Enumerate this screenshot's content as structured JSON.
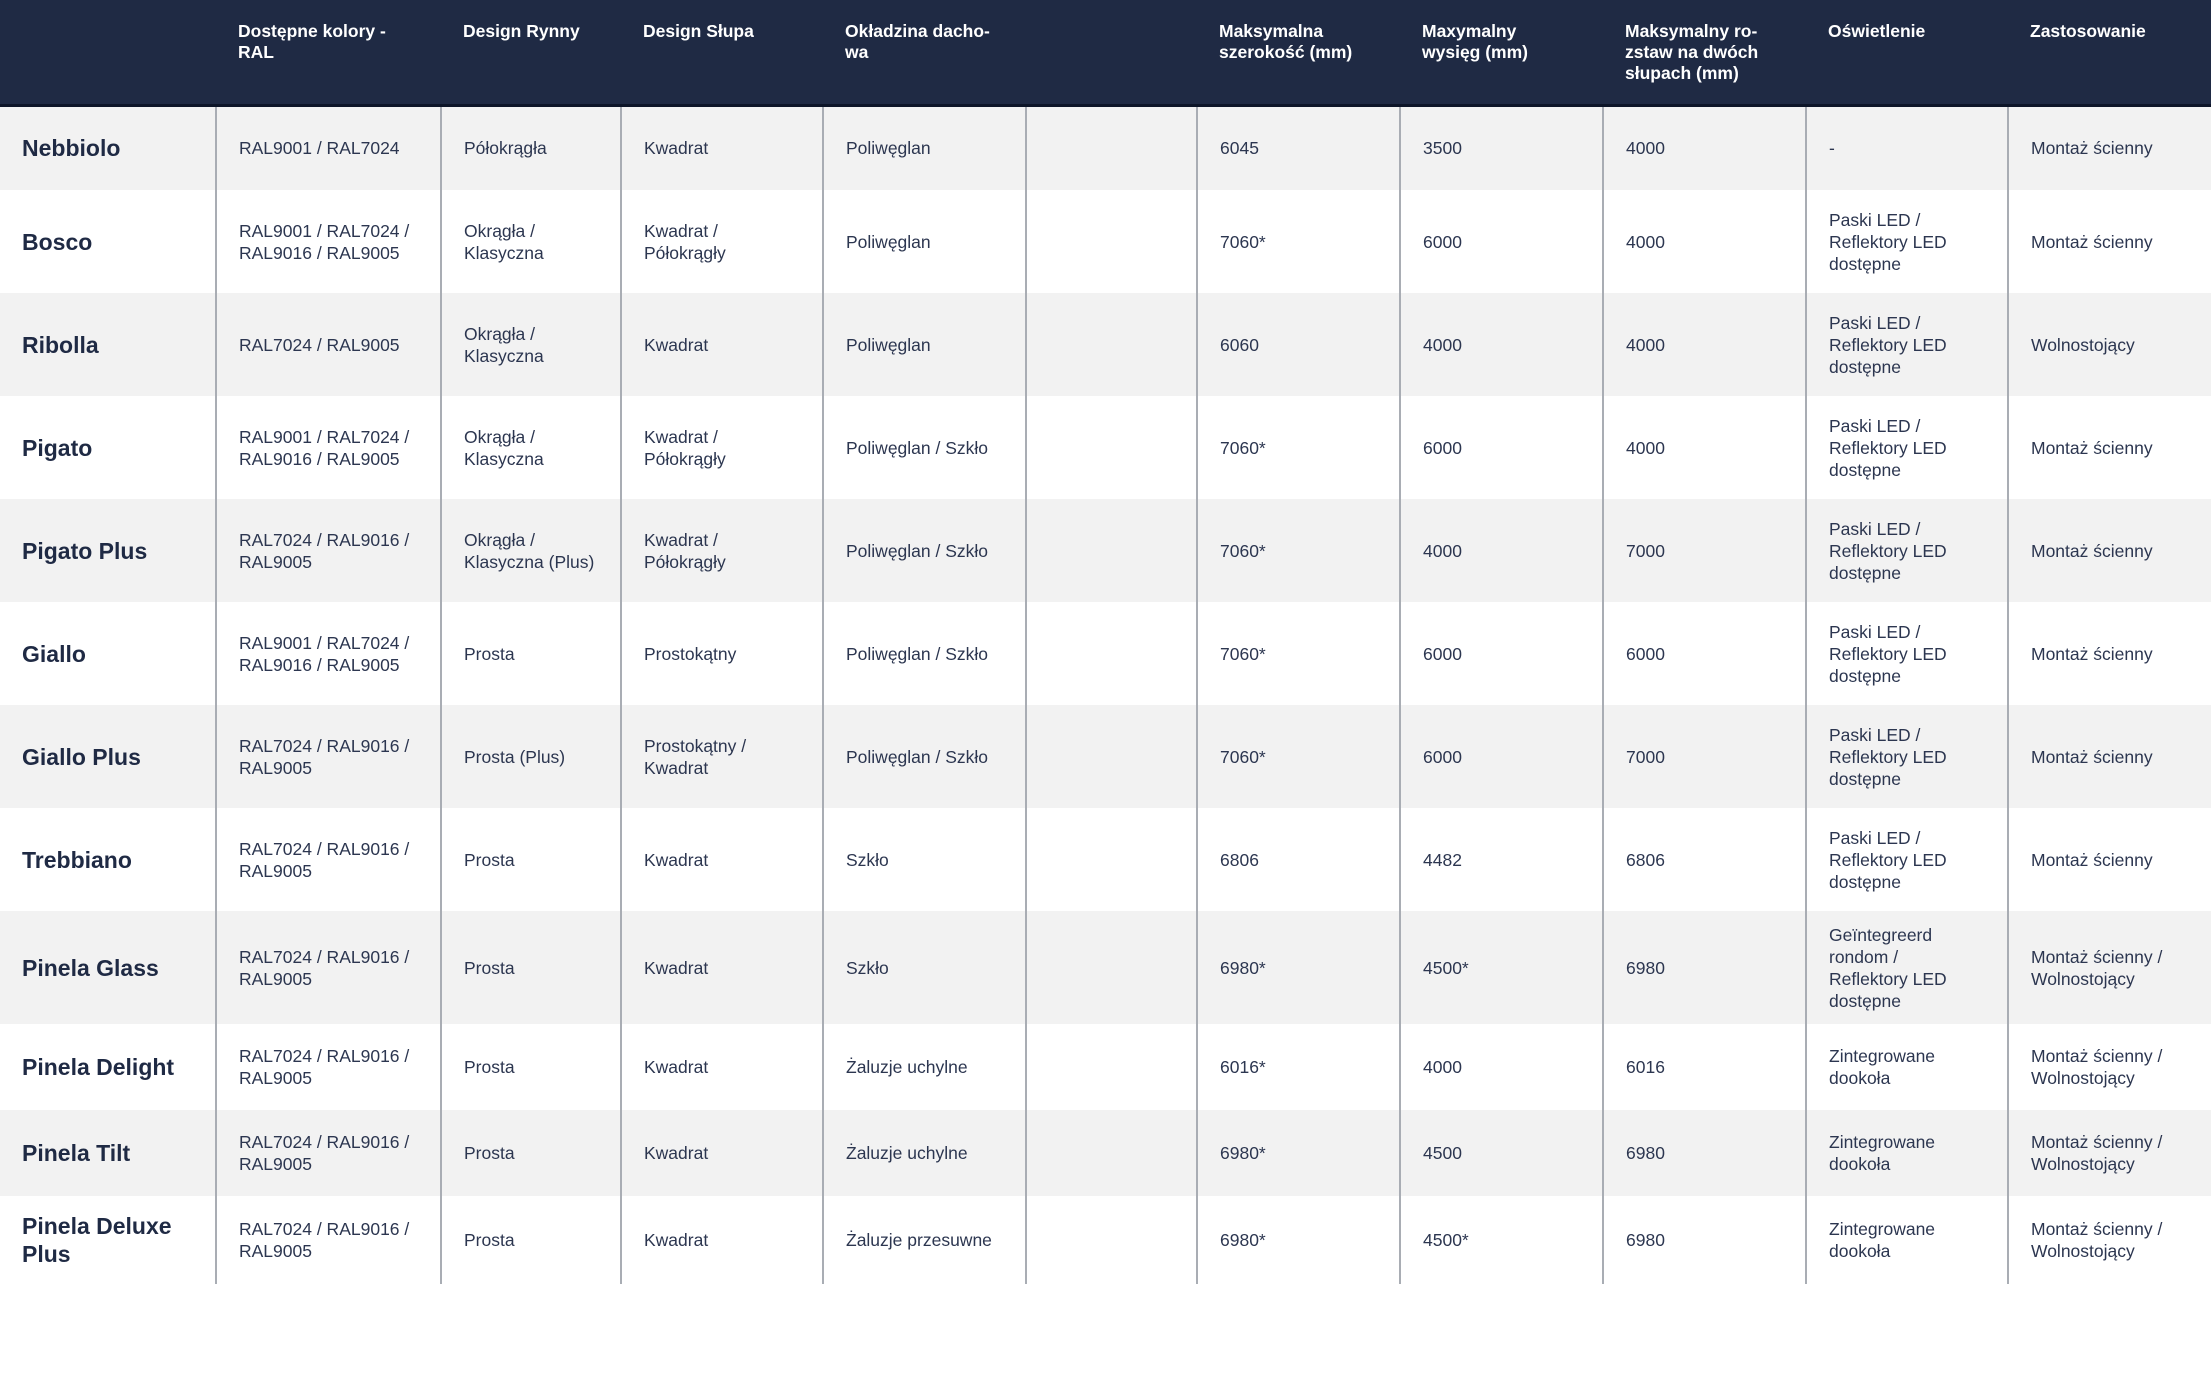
{
  "columns": [
    "",
    "Dostępne kolory -\nRAL",
    "Design Rynny",
    "Design Słupa",
    "Okładzina dacho-\nwa",
    "",
    "Maksymalna\nszerokość (mm)",
    "Maxymalny\nwysięg (mm)",
    "Maksymalny ro-\nzstaw na dwóch\nsłupach (mm)",
    "Oświetlenie",
    "Zastosowanie"
  ],
  "rows": [
    [
      "Nebbiolo",
      "RAL9001 / RAL7024",
      "Półokrągła",
      "Kwadrat",
      "Poliwęglan",
      "",
      "6045",
      "3500",
      "4000",
      "-",
      "Montaż ścienny"
    ],
    [
      "Bosco",
      "RAL9001 / RAL7024 /\nRAL9016 / RAL9005",
      "Okrągła /\nKlasyczna",
      "Kwadrat /\nPółokrągły",
      "Poliwęglan",
      "",
      "7060*",
      "6000",
      "4000",
      "Paski LED /\nReflektory LED\ndostępne",
      "Montaż ścienny"
    ],
    [
      "Ribolla",
      "RAL7024 / RAL9005",
      "Okrągła /\nKlasyczna",
      "Kwadrat",
      "Poliwęglan",
      "",
      "6060",
      "4000",
      "4000",
      "Paski LED /\nReflektory LED\ndostępne",
      "Wolnostojący"
    ],
    [
      "Pigato",
      "RAL9001 / RAL7024 /\nRAL9016 / RAL9005",
      "Okrągła /\nKlasyczna",
      "Kwadrat /\nPółokrągły",
      "Poliwęglan / Szkło",
      "",
      "7060*",
      "6000",
      "4000",
      "Paski LED /\nReflektory LED\ndostępne",
      "Montaż ścienny"
    ],
    [
      "Pigato Plus",
      "RAL7024 / RAL9016 /\nRAL9005",
      "Okrągła /\nKlasyczna (Plus)",
      "Kwadrat /\nPółokrągły",
      "Poliwęglan / Szkło",
      "",
      "7060*",
      "4000",
      "7000",
      "Paski LED /\nReflektory LED\ndostępne",
      "Montaż ścienny"
    ],
    [
      "Giallo",
      "RAL9001 / RAL7024 /\nRAL9016 / RAL9005",
      "Prosta",
      "Prostokątny",
      "Poliwęglan / Szkło",
      "",
      "7060*",
      "6000",
      "6000",
      "Paski LED /\nReflektory LED\ndostępne",
      "Montaż ścienny"
    ],
    [
      "Giallo Plus",
      "RAL7024 / RAL9016 /\nRAL9005",
      "Prosta (Plus)",
      "Prostokątny /\nKwadrat",
      "Poliwęglan / Szkło",
      "",
      "7060*",
      "6000",
      "7000",
      "Paski LED /\nReflektory LED\ndostępne",
      "Montaż ścienny"
    ],
    [
      "Trebbiano",
      "RAL7024 / RAL9016 /\nRAL9005",
      "Prosta",
      "Kwadrat",
      "Szkło",
      "",
      "6806",
      "4482",
      "6806",
      "Paski LED /\nReflektory LED\ndostępne",
      "Montaż ścienny"
    ],
    [
      "Pinela Glass",
      "RAL7024 / RAL9016 /\nRAL9005",
      "Prosta",
      "Kwadrat",
      "Szkło",
      "",
      "6980*",
      "4500*",
      "6980",
      "Geïntegreerd\nrondom /\nReflektory LED\ndostępne",
      "Montaż ścienny /\nWolnostojący"
    ],
    [
      "Pinela Delight",
      "RAL7024 / RAL9016 /\nRAL9005",
      "Prosta",
      "Kwadrat",
      "Żaluzje uchylne",
      "",
      "6016*",
      "4000",
      "6016",
      "Zintegrowane\ndookoła",
      "Montaż ścienny /\nWolnostojący"
    ],
    [
      "Pinela Tilt",
      "RAL7024 / RAL9016 /\nRAL9005",
      "Prosta",
      "Kwadrat",
      "Żaluzje uchylne",
      "",
      "6980*",
      "4500",
      "6980",
      "Zintegrowane\ndookoła",
      "Montaż ścienny /\nWolnostojący"
    ],
    [
      "Pinela Deluxe\nPlus",
      "RAL7024 / RAL9016 /\nRAL9005",
      "Prosta",
      "Kwadrat",
      "Żaluzje przesuwne",
      "",
      "6980*",
      "4500*",
      "6980",
      "Zintegrowane\ndookoła",
      "Montaż ścienny /\nWolnostojący"
    ]
  ]
}
